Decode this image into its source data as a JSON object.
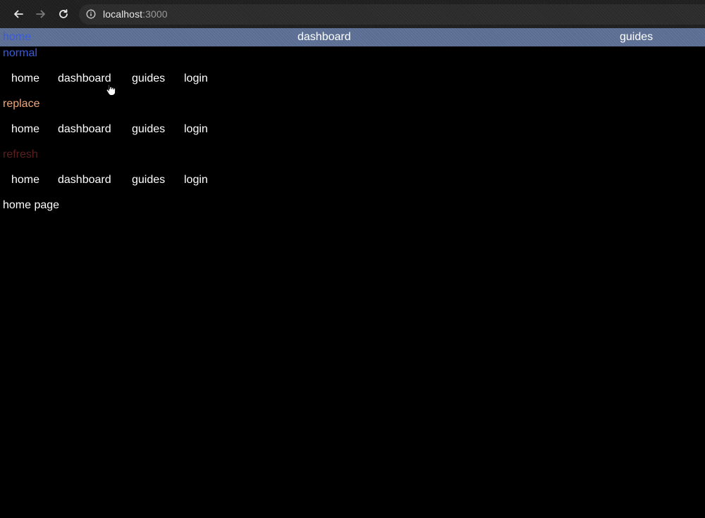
{
  "browser": {
    "url_host": "localhost",
    "url_port": ":3000",
    "back_icon": "arrow-left-icon",
    "forward_icon": "arrow-right-icon",
    "reload_icon": "reload-icon",
    "info_icon": "info-icon"
  },
  "top_nav": {
    "items": [
      {
        "label": "home",
        "color": "#3a5bd8"
      },
      {
        "label": "dashboard",
        "color": "#ffffff"
      },
      {
        "label": "guides",
        "color": "#ffffff"
      }
    ],
    "background": "#5a6d92"
  },
  "sections": [
    {
      "label": "normal",
      "color": "#3b5bdb",
      "links": [
        "home",
        "dashboard",
        "guides",
        "login"
      ]
    },
    {
      "label": "replace",
      "color": "#f0a778",
      "links": [
        "home",
        "dashboard",
        "guides",
        "login"
      ]
    },
    {
      "label": "refresh",
      "color": "#5a1f1f",
      "links": [
        "home",
        "dashboard",
        "guides",
        "login"
      ]
    }
  ],
  "page": {
    "content": "home page"
  },
  "cursor": "hand-pointer-icon"
}
